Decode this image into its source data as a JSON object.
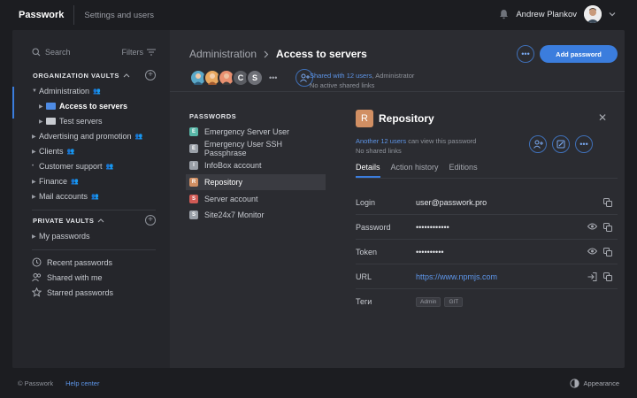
{
  "app": {
    "brand": "Passwork",
    "section": "Settings and users"
  },
  "user": {
    "name": "Andrew Plankov"
  },
  "sidebar": {
    "search_placeholder": "Search",
    "filters_label": "Filters",
    "org_vaults_title": "ORGANIZATION VAULTS",
    "org_items": [
      {
        "label": "Administration"
      },
      {
        "label": "Access to servers"
      },
      {
        "label": "Test servers"
      },
      {
        "label": "Advertising and promotion"
      },
      {
        "label": "Clients"
      },
      {
        "label": "Customer support"
      },
      {
        "label": "Finance"
      },
      {
        "label": "Mail accounts"
      }
    ],
    "private_vaults_title": "PRIVATE VAULTS",
    "private_items": [
      {
        "label": "My passwords"
      }
    ],
    "bottom_links": [
      {
        "label": "Recent passwords",
        "icon": "clock-icon"
      },
      {
        "label": "Shared with me",
        "icon": "users-icon"
      },
      {
        "label": "Starred passwords",
        "icon": "star-icon"
      }
    ]
  },
  "main": {
    "breadcrumb_parent": "Administration",
    "breadcrumb_current": "Access to servers",
    "add_button": "Add password",
    "shared_link": "Shared with 12 users",
    "shared_role": ", Administrator",
    "shared_links_status": "No active shared links",
    "avatar_letters": [
      "C",
      "S"
    ],
    "passwords_title": "PASSWORDS",
    "passwords": [
      {
        "letter": "E",
        "name": "Emergency Server User",
        "color": "#58b7a8"
      },
      {
        "letter": "E",
        "name": "Emergency User SSH Passphrase",
        "color": "#9aa0a8"
      },
      {
        "letter": "I",
        "name": "InfoBox account",
        "color": "#9aa0a8"
      },
      {
        "letter": "R",
        "name": "Repository",
        "color": "#d18f63"
      },
      {
        "letter": "S",
        "name": "Server account",
        "color": "#d05a55"
      },
      {
        "letter": "S",
        "name": "Site24x7 Monitor",
        "color": "#9aa0a8"
      }
    ]
  },
  "detail": {
    "letter": "R",
    "title": "Repository",
    "share_link": "Another 12 users",
    "share_rest": " can view this password",
    "shared_links_status": "No shared links",
    "tabs": [
      "Details",
      "Action history",
      "Editions"
    ],
    "fields": [
      {
        "label": "Login",
        "value": "user@passwork.pro"
      },
      {
        "label": "Password",
        "value": "••••••••••••"
      },
      {
        "label": "Token",
        "value": "••••••••••"
      },
      {
        "label": "URL",
        "value": "https://www.npmjs.com"
      },
      {
        "label": "Теги",
        "value": ""
      }
    ],
    "tags": [
      "Admin",
      "GIT"
    ]
  },
  "footer": {
    "copyright": "© Passwork",
    "help": "Help center",
    "appearance": "Appearance"
  }
}
